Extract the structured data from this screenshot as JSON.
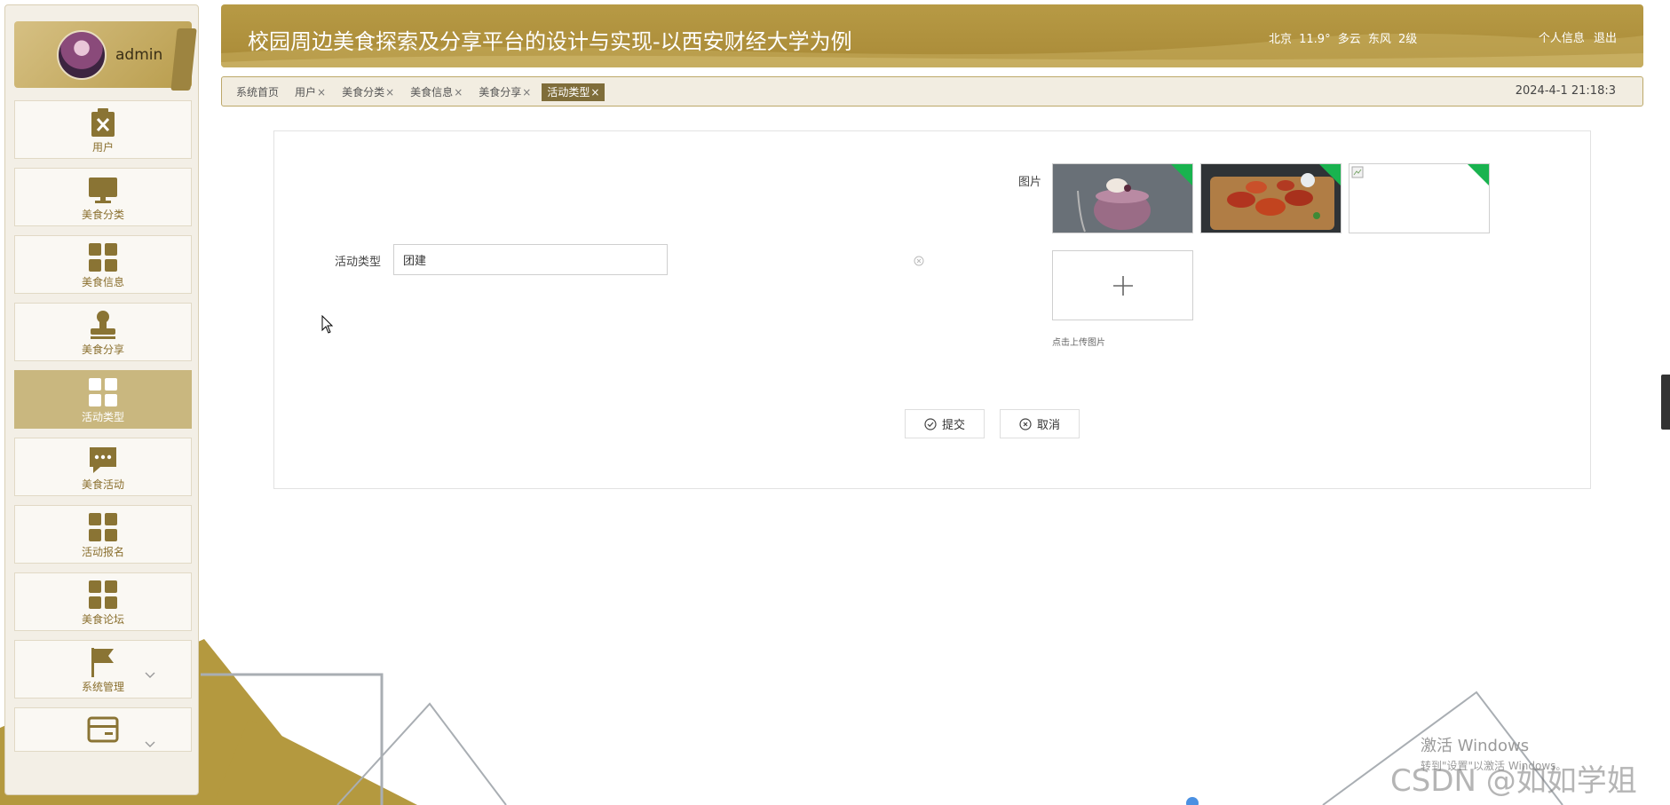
{
  "user": {
    "name": "admin"
  },
  "sidebar": {
    "items": [
      {
        "label": "用户",
        "icon": "clipboard-x-icon"
      },
      {
        "label": "美食分类",
        "icon": "monitor-icon"
      },
      {
        "label": "美食信息",
        "icon": "grid-icon"
      },
      {
        "label": "美食分享",
        "icon": "stamp-icon"
      },
      {
        "label": "活动类型",
        "icon": "grid-icon",
        "active": true
      },
      {
        "label": "美食活动",
        "icon": "chat-bubble-icon"
      },
      {
        "label": "活动报名",
        "icon": "grid-icon"
      },
      {
        "label": "美食论坛",
        "icon": "grid-icon"
      },
      {
        "label": "系统管理",
        "icon": "flag-icon",
        "expandable": true
      },
      {
        "label": "",
        "icon": "card-icon",
        "expandable": true
      }
    ]
  },
  "header": {
    "title": "校园周边美食探索及分享平台的设计与实现-以西安财经大学为例",
    "weather": "北京 11.9° 多云 东风 2级",
    "profile_link": "个人信息",
    "logout_link": "退出"
  },
  "tabs": {
    "items": [
      {
        "label": "系统首页",
        "closable": false
      },
      {
        "label": "用户",
        "closable": true
      },
      {
        "label": "美食分类",
        "closable": true
      },
      {
        "label": "美食信息",
        "closable": true
      },
      {
        "label": "美食分享",
        "closable": true
      },
      {
        "label": "活动类型",
        "closable": true,
        "active": true
      }
    ],
    "close_glyph": "×",
    "datetime": "2024-4-1 21:18:3"
  },
  "form": {
    "type_label": "活动类型",
    "type_value": "团建",
    "image_label": "图片",
    "images": [
      "dessert-bowl-photo",
      "chicken-wings-photo",
      "broken-image"
    ],
    "upload_tip": "点击上传图片",
    "submit_label": "提交",
    "cancel_label": "取消"
  },
  "overlay": {
    "activate_title": "激活 Windows",
    "activate_sub": "转到\"设置\"以激活 Windows。",
    "watermark": "CSDN @如如学姐"
  },
  "colors": {
    "accent": "#b79a45",
    "active_tab": "#7f6d3a",
    "sidebar_active": "#c9b77f",
    "badge": "#19b34f"
  }
}
